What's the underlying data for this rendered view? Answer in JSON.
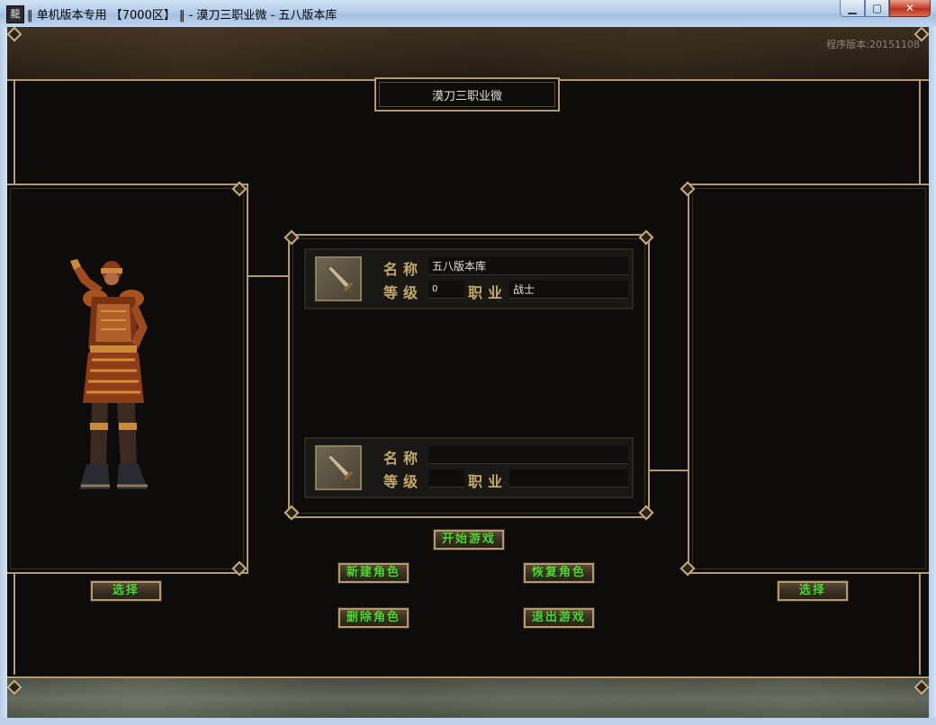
{
  "window": {
    "title": "‖ 单机版本专用 【7000区】 ‖ - 漠刀三职业微 - 五八版本库",
    "icon_char": "龍",
    "minimize_glyph": "▁",
    "maximize_glyph": "▢",
    "close_glyph": "✕"
  },
  "version_label": "程序版本:20151108",
  "server_name": "漠刀三职业微",
  "slots": [
    {
      "name_label": "名称",
      "name_value": "五八版本库",
      "level_label": "等级",
      "level_value": "0",
      "class_label": "职业",
      "class_value": "战士"
    },
    {
      "name_label": "名称",
      "name_value": "",
      "level_label": "等级",
      "level_value": "",
      "class_label": "职业",
      "class_value": ""
    }
  ],
  "buttons": {
    "start": "开始游戏",
    "new_char": "新建角色",
    "restore_char": "恢复角色",
    "delete_char": "删除角色",
    "exit": "退出游戏",
    "select_left": "选择",
    "select_right": "选择"
  },
  "colors": {
    "frame_gold": "#b59a70",
    "label_gold": "#c4a968",
    "button_text_green": "#58d630",
    "background": "#0d0c0a"
  },
  "icons": {
    "slot_icon": "sword-icon",
    "character": "warrior-character"
  }
}
